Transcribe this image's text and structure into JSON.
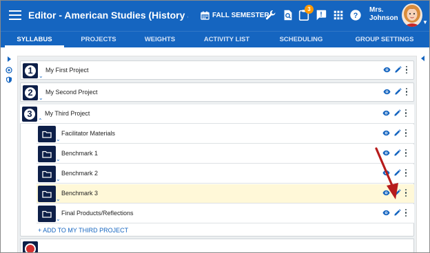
{
  "header": {
    "title": "Editor - American Studies (History and L...",
    "semester": "FALL SEMESTER",
    "notification_count": "3",
    "user_line1": "Mrs.",
    "user_line2": "Johnson"
  },
  "tabs": [
    {
      "label": "SYLLABUS",
      "active": true
    },
    {
      "label": "PROJECTS",
      "active": false
    },
    {
      "label": "WEIGHTS",
      "active": false
    },
    {
      "label": "ACTIVITY LIST",
      "active": false
    },
    {
      "label": "SCHEDULING",
      "active": false
    },
    {
      "label": "GROUP SETTINGS",
      "active": false
    }
  ],
  "projects": [
    {
      "number": "1",
      "label": "My First Project"
    },
    {
      "number": "2",
      "label": "My Second Project"
    },
    {
      "number": "3",
      "label": "My Third Project"
    }
  ],
  "subitems": [
    {
      "label": "Facilitator Materials",
      "highlighted": false
    },
    {
      "label": "Benchmark 1",
      "highlighted": false
    },
    {
      "label": "Benchmark 2",
      "highlighted": false
    },
    {
      "label": "Benchmark 3",
      "highlighted": true
    },
    {
      "label": "Final Products/Reflections",
      "highlighted": false
    }
  ],
  "add_link": "+ ADD TO MY THIRD PROJECT",
  "colors": {
    "header_blue": "#1565c0",
    "dark_navy": "#0d1f48",
    "highlight": "#fff8d8",
    "badge_orange": "#ff9800",
    "arrow_red": "#b71c1c"
  },
  "icons": {
    "menu": "hamburger-icon",
    "semester": "calendar-icon",
    "tools": [
      "wrench-icon",
      "search-document-icon",
      "clipboard-icon",
      "chat-alert-icon",
      "apps-grid-icon",
      "help-icon"
    ],
    "row_actions": [
      "eye-icon",
      "pencil-icon",
      "more-vertical-icon"
    ],
    "folder": "folder-icon"
  }
}
